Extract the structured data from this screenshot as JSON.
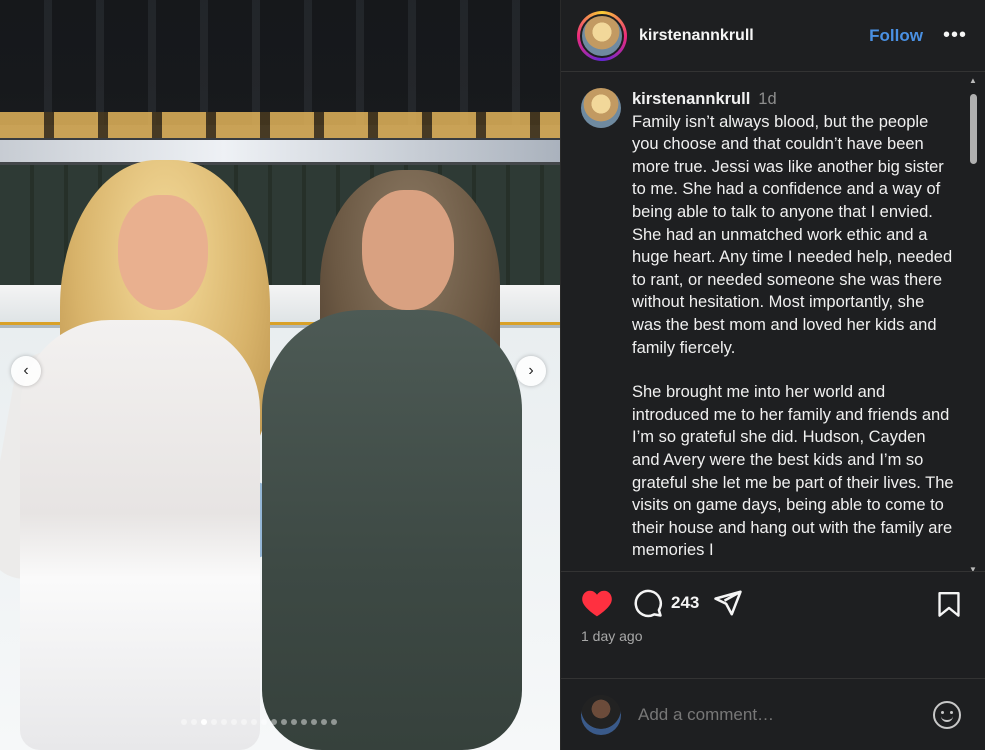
{
  "post": {
    "username": "kirstenannkrull",
    "follow_label": "Follow",
    "more_label": "•••",
    "caption_time": "1d",
    "caption_paragraphs": [
      "Family isn’t always blood, but the people you choose and that couldn’t have been more true. Jessi was like another big sister to me. She had a confidence and a way of being able to talk to anyone that I envied. She had an unmatched work ethic and a huge heart. Any time I needed help, needed to rant, or needed someone she was there without hesitation. Most importantly, she was the best mom and loved her kids and family fiercely.",
      "She brought me into her world and introduced me to her family and friends and I’m so grateful she did. Hudson, Cayden and Avery were the best kids and I’m so grateful she let me be part of their lives. The visits on game days, being able to come to their house and hang out with the family are memories I"
    ],
    "comment_count": "243",
    "posted_ago": "1 day ago",
    "comment_placeholder": "Add a comment…",
    "liked": true,
    "like_color": "#ff3040"
  },
  "carousel": {
    "slide_count": 16,
    "active_index": 2,
    "prev_label": "‹",
    "next_label": "›"
  },
  "icons": {
    "like": "heart-icon",
    "comment": "comment-bubble-icon",
    "share": "send-paper-plane-icon",
    "save": "bookmark-icon",
    "more": "more-options-icon",
    "emoji": "emoji-smile-icon"
  }
}
